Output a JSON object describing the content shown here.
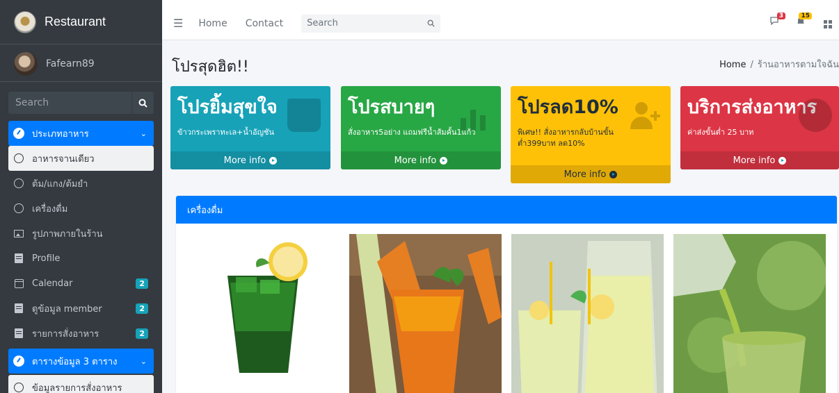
{
  "brand": {
    "title": "Restaurant"
  },
  "user": {
    "name": "Fafearn89"
  },
  "sidebar_search": {
    "placeholder": "Search"
  },
  "sidebar": {
    "items": [
      {
        "label": "ประเภทอาหาร"
      },
      {
        "label": "อาหารจานเดียว"
      },
      {
        "label": "ต้ม/แกง/ต้มยำ"
      },
      {
        "label": "เครื่องดื่ม"
      },
      {
        "label": "รูปภาพภายในร้าน"
      },
      {
        "label": "Profile"
      },
      {
        "label": "Calendar",
        "badge": "2"
      },
      {
        "label": "ดูข้อมูล member",
        "badge": "2"
      },
      {
        "label": "รายการสั่งอาหาร",
        "badge": "2"
      },
      {
        "label": "ตารางข้อมูล 3 ตาราง"
      },
      {
        "label": "ข้อมูลรายการสั่งอาหาร"
      }
    ]
  },
  "topnav": {
    "home": "Home",
    "contact": "Contact",
    "search_placeholder": "Search",
    "messages_count": "3",
    "notifications_count": "15"
  },
  "page": {
    "title": "โปรสุดฮิต!!",
    "breadcrumb_home": "Home",
    "breadcrumb_current": "ร้านอาหารตามใจฉัน"
  },
  "promos": [
    {
      "title": "โปรยิ้มสุขใจ",
      "text": "ข้าวกระเพราทะเล+น้ำอัญชัน",
      "more": "More info",
      "color": "#17a2b8"
    },
    {
      "title": "โปรสบายๆ",
      "text": "สั่งอาหาร5อย่าง แถมฟรีน้ำส้มคั้น1แก้ว",
      "more": "More info",
      "color": "#28a745"
    },
    {
      "title": "โปรลด10%",
      "text": "พิเศษ!! สั่งอาหารกลับบ้านขั้นต่ำ399บาท ลด10%",
      "more": "More info",
      "color": "#ffc107"
    },
    {
      "title": "บริการส่งอาหาร",
      "text": "ค่าส่งขั้นต่ำ 25 บาท",
      "more": "More info",
      "color": "#dc3545"
    }
  ],
  "drinks_card": {
    "title": "เครื่องดื่ม"
  },
  "colors": {
    "sidebar": "#343a40",
    "primary": "#007bff"
  }
}
